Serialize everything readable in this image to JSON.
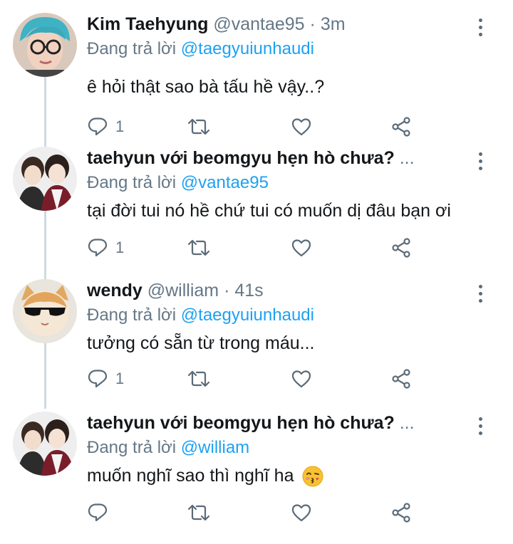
{
  "tweets": [
    {
      "name": "Kim Taehyung",
      "handle": "@vantae95",
      "time": "3m",
      "replying_label": "Đang trả lời",
      "replying_to": "@taegyuiunhaudi",
      "text": "ê hỏi thật sao bà tấu hề vậy..?",
      "reply_count": "1",
      "avatar": "avatar-teal-hair-glasses"
    },
    {
      "name": "taehyun với beomgyu hẹn hò chưa?",
      "handle": "...",
      "time": "",
      "replying_label": "Đang trả lời",
      "replying_to": "@vantae95",
      "text": "tại đời tui nó hề chứ tui có muốn dị đâu bạn ơi",
      "reply_count": "1",
      "avatar": "avatar-two-boys"
    },
    {
      "name": "wendy",
      "handle": "@william",
      "time": "41s",
      "replying_label": "Đang trả lời",
      "replying_to": "@taegyuiunhaudi",
      "text": "tưởng có sẵn từ trong máu...",
      "reply_count": "1",
      "avatar": "avatar-cat-sunglasses"
    },
    {
      "name": "taehyun với beomgyu hẹn hò chưa?",
      "handle": "...",
      "time": "",
      "replying_label": "Đang trả lời",
      "replying_to": "@william",
      "text": "muốn nghĩ sao thì nghĩ ha",
      "reply_count": "",
      "emoji": "kissing-face-emoji",
      "avatar": "avatar-two-boys"
    }
  ],
  "separator": "·",
  "icons": [
    "reply-icon",
    "retweet-icon",
    "like-icon",
    "share-icon",
    "more-vertical-icon"
  ],
  "colors": {
    "text": "#14171a",
    "secondary": "#657786",
    "mention": "#1da1f2",
    "thread_line": "#cfd9de"
  }
}
